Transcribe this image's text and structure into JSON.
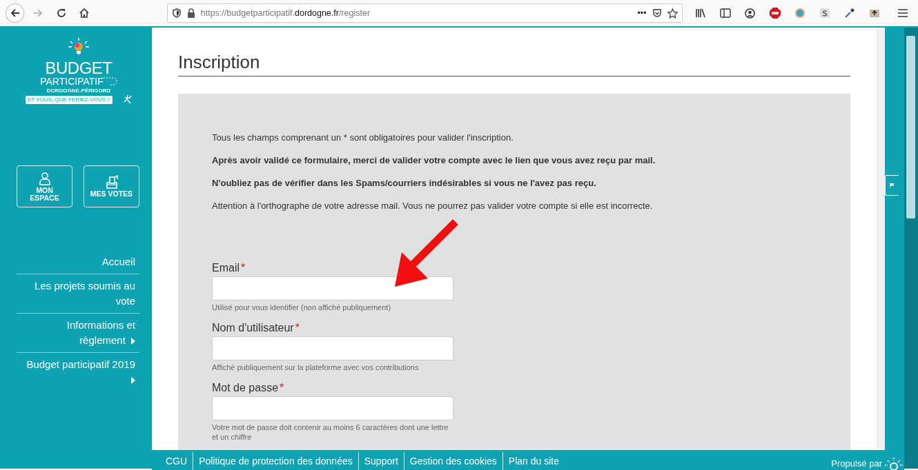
{
  "browser": {
    "url_parts": [
      "https://budgetparticipatif.",
      "dordogne.fr",
      "/register"
    ],
    "forward_disabled": true,
    "page_actions": "•••"
  },
  "sidebar": {
    "logo": {
      "title": "BUDGET",
      "subtitle": "PARTICIPATIF",
      "region": "DORDOGNE-PÉRIGORD",
      "tagline": "ET VOUS, QUE FERIEZ-VOUS ?"
    },
    "buttons": [
      {
        "kind": "person",
        "label": "MON ESPACE"
      },
      {
        "kind": "ballot",
        "label": "MES VOTES"
      }
    ],
    "nav": [
      {
        "label": "Accueil",
        "submenu": false
      },
      {
        "label": "Les projets soumis au vote",
        "submenu": false
      },
      {
        "label": "Informations et règlement",
        "submenu": true
      },
      {
        "label": "Budget participatif 2019",
        "submenu": true
      }
    ]
  },
  "page": {
    "title": "Inscription",
    "intro": [
      {
        "text": "Tous les champs comprenant un * sont obligatoires pour valider l'inscription.",
        "bold": false
      },
      {
        "text": "Après avoir validé ce formulaire, merci de valider votre compte avec le lien que vous avez reçu par mail.",
        "bold": true
      },
      {
        "text": "N'oubliez pas de vérifier dans les Spams/courriers indésirables si vous ne l'avez pas reçu.",
        "bold": true
      },
      {
        "text": "Attention à l'orthographe de votre adresse mail. Vous ne pourrez pas valider votre compte si elle est incorrecte.",
        "bold": false
      }
    ],
    "fields": [
      {
        "label": "Email",
        "required": true,
        "marker": "*",
        "help": "Utilisé pour vous identifier (non affiché publiquement)"
      },
      {
        "label": "Nom d'utilisateur",
        "required": true,
        "marker": "*",
        "help": "Affiché publiquement sur la plateforme avec vos contributions"
      },
      {
        "label": "Mot de passe",
        "required": true,
        "marker": "*",
        "help": "Votre mot de passe doit contenir au moins 6 caractères dont une lettre et un chiffre"
      }
    ]
  },
  "footer": {
    "links": [
      "CGU",
      "Politique de protection des données",
      "Support",
      "Gestion des cookies",
      "Plan du site"
    ],
    "powered_by": "Propulsé par"
  }
}
